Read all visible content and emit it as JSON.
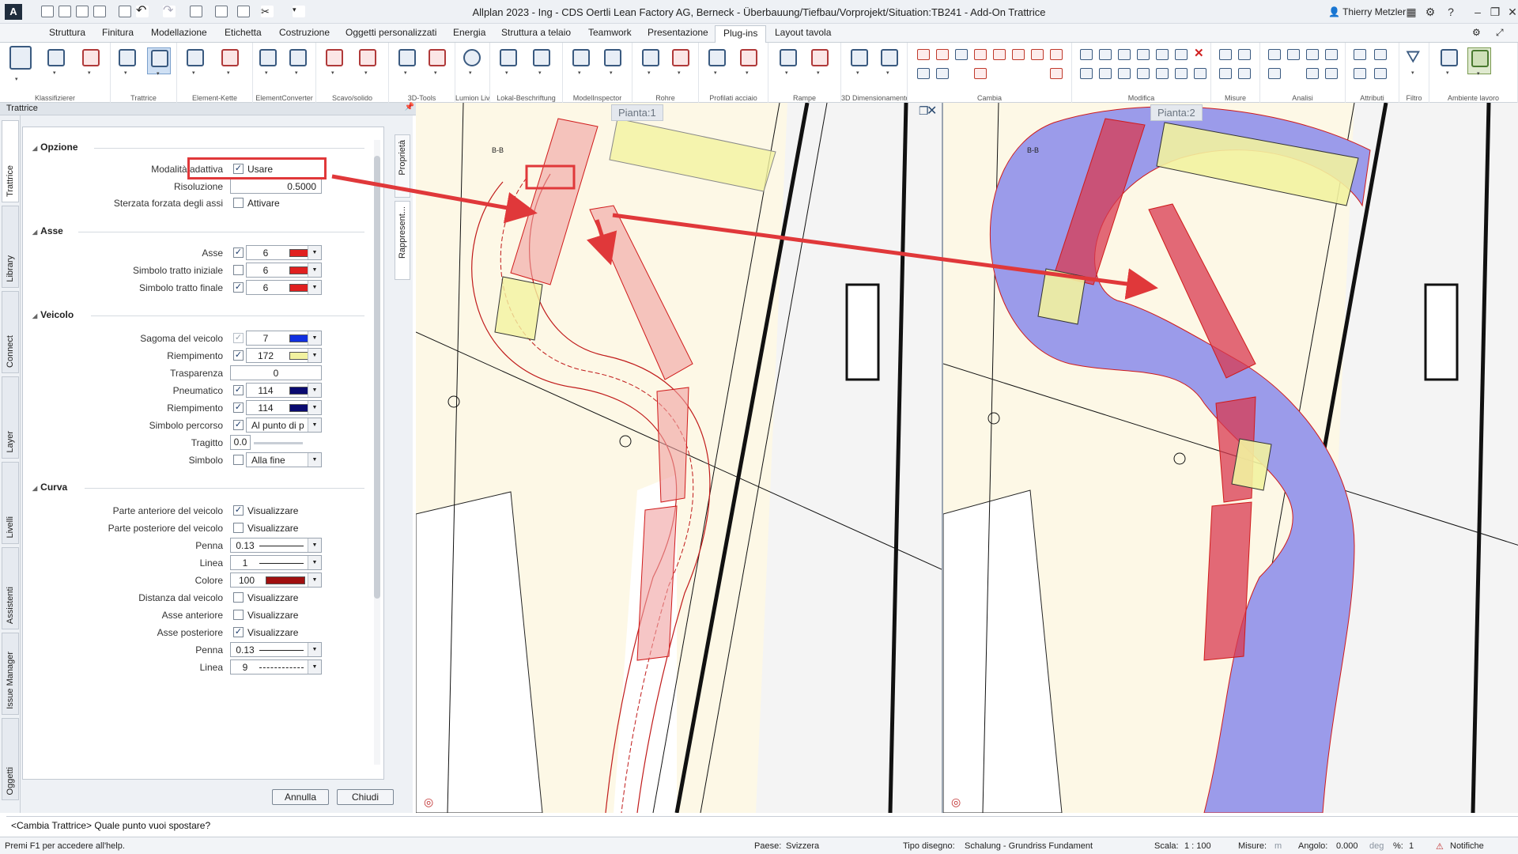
{
  "titlebar": {
    "title": "Allplan 2023 - Ing - CDS Oertli Lean Factory AG, Berneck - Überbauung/Tiefbau/Vorprojekt/Situation:TB241 - Add-On Trattrice",
    "logo": "A",
    "user": "Thierry Metzler",
    "help": "?"
  },
  "menu": [
    "Struttura",
    "Finitura",
    "Modellazione",
    "Etichetta",
    "Costruzione",
    "Oggetti personalizzati",
    "Energia",
    "Struttura a telaio",
    "Teamwork",
    "Presentazione",
    "Plug-ins",
    "Layout tavola"
  ],
  "menu_active": "Plug-ins",
  "ribbon_groups": [
    "Klassifizierer",
    "Trattrice",
    "Element-Kette",
    "ElementConverter",
    "Scavo/solido",
    "3D-Tools",
    "Lumion LiveSync",
    "Lokal-Beschriftung",
    "ModelInspector",
    "Rohre",
    "Profilati acciaio",
    "Rampe",
    "3D Dimensionamento",
    "Cambia",
    "Modifica",
    "Misure",
    "Analisi",
    "Attributi",
    "Filtro",
    "Ambiente lavoro"
  ],
  "palette": {
    "title": "Trattrice"
  },
  "left_tabs": [
    "Trattrice",
    "Library",
    "Connect",
    "Layer",
    "Livelli",
    "Assistenti",
    "Issue Manager",
    "Oggetti"
  ],
  "side_tabs": [
    "Proprietà",
    "Rappresent..."
  ],
  "sections": {
    "opzione": "Opzione",
    "asse": "Asse",
    "veicolo": "Veicolo",
    "curva": "Curva"
  },
  "opzione": {
    "modalita_label": "Modalità adattiva",
    "modalita_check": "✓",
    "modalita_text": "Usare",
    "risoluzione_label": "Risoluzione",
    "risoluzione_value": "0.5000",
    "sterzata_label": "Sterzata forzata degli assi",
    "sterzata_check": "",
    "sterzata_text": "Attivare"
  },
  "asse": [
    {
      "label": "Asse",
      "check": "✓",
      "num": "6",
      "color": "#e02020"
    },
    {
      "label": "Simbolo tratto iniziale",
      "check": "",
      "num": "6",
      "color": "#e02020"
    },
    {
      "label": "Simbolo tratto finale",
      "check": "✓",
      "num": "6",
      "color": "#e02020"
    }
  ],
  "veicolo": {
    "sagoma": {
      "label": "Sagoma del veicolo",
      "check": "✓",
      "num": "7",
      "color": "#1030e0"
    },
    "riempimento1": {
      "label": "Riempimento",
      "check": "✓",
      "num": "172",
      "color": "#f2f2a0"
    },
    "trasparenza": {
      "label": "Trasparenza",
      "value": "0"
    },
    "pneumatico": {
      "label": "Pneumatico",
      "check": "✓",
      "num": "114",
      "color": "#0a0a70"
    },
    "riempimento2": {
      "label": "Riempimento",
      "check": "✓",
      "num": "114",
      "color": "#0a0a70"
    },
    "percorso": {
      "label": "Simbolo percorso",
      "check": "✓",
      "value": "Al punto di p"
    },
    "tragitto": {
      "label": "Tragitto",
      "value": "0.0"
    },
    "simbolo": {
      "label": "Simbolo",
      "check": "",
      "value": "Alla fine"
    }
  },
  "curva": {
    "anteriore": {
      "label": "Parte anteriore del veicolo",
      "check": "✓",
      "text": "Visualizzare"
    },
    "posteriore": {
      "label": "Parte posteriore del veicolo",
      "check": "",
      "text": "Visualizzare"
    },
    "penna1": {
      "label": "Penna",
      "value": "0.13"
    },
    "linea1": {
      "label": "Linea",
      "value": "1"
    },
    "colore": {
      "label": "Colore",
      "num": "100",
      "color": "#a01010"
    },
    "distanza": {
      "label": "Distanza dal veicolo",
      "check": "",
      "text": "Visualizzare"
    },
    "asse_ant": {
      "label": "Asse anteriore",
      "check": "",
      "text": "Visualizzare"
    },
    "asse_post": {
      "label": "Asse posteriore",
      "check": "✓",
      "text": "Visualizzare"
    },
    "penna2": {
      "label": "Penna",
      "value": "0.13"
    },
    "linea2": {
      "label": "Linea",
      "value": "9"
    }
  },
  "buttons": {
    "annulla": "Annulla",
    "chiudi": "Chiudi"
  },
  "viewports": {
    "v1": "Pianta:1",
    "v2": "Pianta:2"
  },
  "drawing_labels": {
    "b": "B-B"
  },
  "prompt": "<Cambia Trattrice> Quale punto vuoi spostare?",
  "status": {
    "help": "Premi F1 per accedere all'help.",
    "paese_label": "Paese:",
    "paese": "Svizzera",
    "tipo_label": "Tipo disegno:",
    "tipo": "Schalung  -  Grundriss Fundament",
    "scala_label": "Scala:",
    "scala": "1 : 100",
    "misure_label": "Misure:",
    "misure": "m",
    "angolo_label": "Angolo:",
    "angolo": "0.000",
    "angolo_unit": "deg",
    "pct_label": "%:",
    "pct": "1",
    "notifiche": "Notifiche"
  },
  "colors": {
    "highlight": "#e0383a",
    "vehicle_red": "#e83a3a",
    "sweep_blue": "#9b9bea",
    "ground": "#fdf8e6"
  }
}
